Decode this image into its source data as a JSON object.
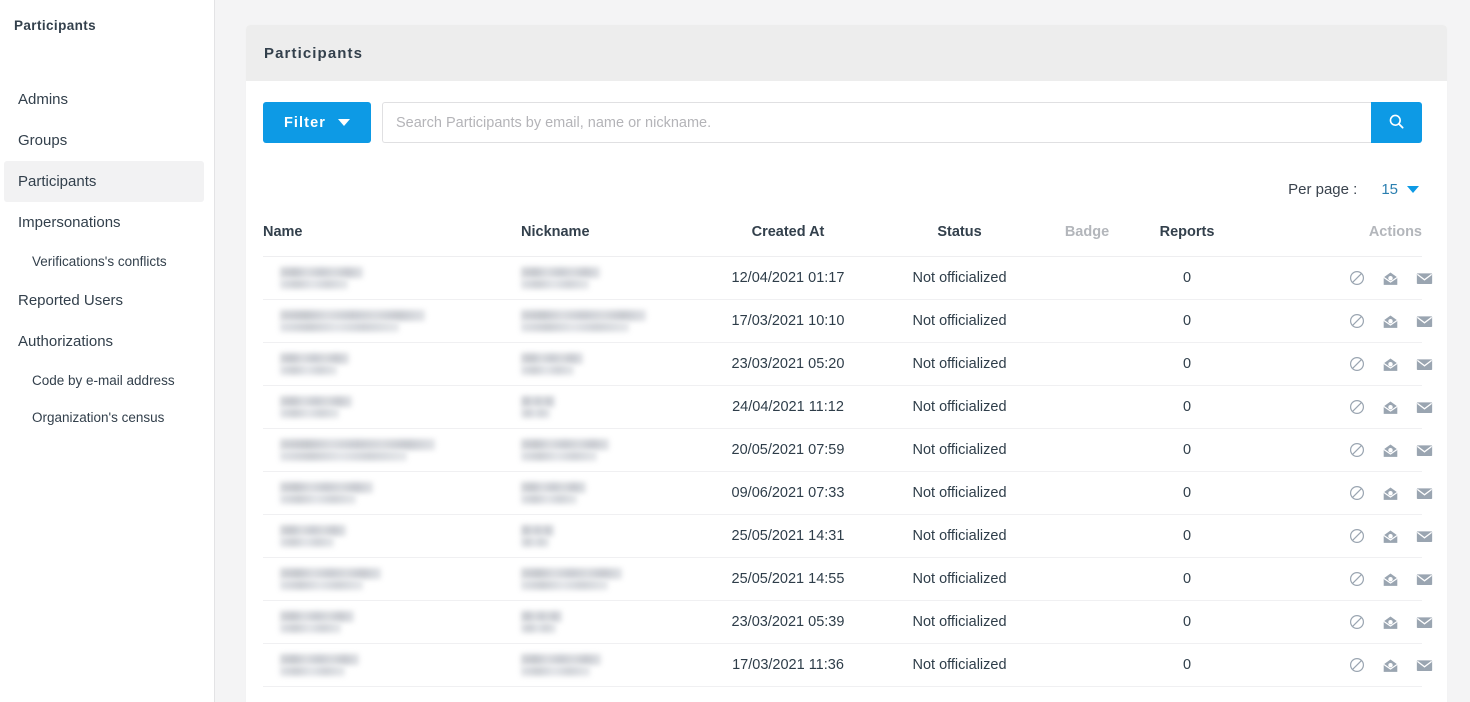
{
  "sidebar": {
    "title": "Participants",
    "items": [
      {
        "label": "Admins",
        "sub": false,
        "active": false
      },
      {
        "label": "Groups",
        "sub": false,
        "active": false
      },
      {
        "label": "Participants",
        "sub": false,
        "active": true
      },
      {
        "label": "Impersonations",
        "sub": false,
        "active": false
      },
      {
        "label": "Verifications's conflicts",
        "sub": true,
        "active": false
      },
      {
        "label": "Reported Users",
        "sub": false,
        "active": false
      },
      {
        "label": "Authorizations",
        "sub": false,
        "active": false
      },
      {
        "label": "Code by e-mail address",
        "sub": true,
        "active": false
      },
      {
        "label": "Organization's census",
        "sub": true,
        "active": false
      }
    ]
  },
  "panel": {
    "header_title": "Participants"
  },
  "toolbar": {
    "filter_label": "Filter",
    "filter_caret_icon": "chevron-down-icon",
    "search_placeholder": "Search Participants by email, name or nickname.",
    "search_value": "",
    "search_button_icon": "search-icon"
  },
  "pagination": {
    "per_page_label": "Per page :",
    "per_page_value": "15",
    "caret_icon": "chevron-down-icon"
  },
  "table": {
    "columns": [
      {
        "key": "name",
        "label": "Name",
        "muted": false
      },
      {
        "key": "nickname",
        "label": "Nickname",
        "muted": false
      },
      {
        "key": "created_at",
        "label": "Created At",
        "muted": false
      },
      {
        "key": "status",
        "label": "Status",
        "muted": false
      },
      {
        "key": "badge",
        "label": "Badge",
        "muted": true
      },
      {
        "key": "reports",
        "label": "Reports",
        "muted": false
      },
      {
        "key": "actions",
        "label": "Actions",
        "muted": true
      }
    ],
    "action_icons": [
      "block-icon",
      "envelope-open-icon",
      "envelope-closed-icon",
      "check-circle-icon",
      "pencil-icon",
      "close-circle-icon"
    ],
    "rows": [
      {
        "name": "",
        "name_redacted": true,
        "name_width": 83,
        "nickname": "",
        "nickname_redacted": true,
        "nickname_width": 79,
        "created_at": "12/04/2021 01:17",
        "status": "Not officialized",
        "badge": "",
        "reports": "0"
      },
      {
        "name": "",
        "name_redacted": true,
        "name_width": 145,
        "nickname": "",
        "nickname_redacted": true,
        "nickname_width": 125,
        "created_at": "17/03/2021 10:10",
        "status": "Not officialized",
        "badge": "",
        "reports": "0"
      },
      {
        "name": "",
        "name_redacted": true,
        "name_width": 69,
        "nickname": "",
        "nickname_redacted": true,
        "nickname_width": 62,
        "created_at": "23/03/2021 05:20",
        "status": "Not officialized",
        "badge": "",
        "reports": "0"
      },
      {
        "name": "",
        "name_redacted": true,
        "name_width": 72,
        "nickname": "",
        "nickname_redacted": true,
        "nickname_width": 34,
        "created_at": "24/04/2021 11:12",
        "status": "Not officialized",
        "badge": "",
        "reports": "0"
      },
      {
        "name": "",
        "name_redacted": true,
        "name_width": 155,
        "nickname": "",
        "nickname_redacted": true,
        "nickname_width": 88,
        "created_at": "20/05/2021 07:59",
        "status": "Not officialized",
        "badge": "",
        "reports": "0"
      },
      {
        "name": "",
        "name_redacted": true,
        "name_width": 93,
        "nickname": "",
        "nickname_redacted": true,
        "nickname_width": 65,
        "created_at": "09/06/2021 07:33",
        "status": "Not officialized",
        "badge": "",
        "reports": "0"
      },
      {
        "name": "",
        "name_redacted": true,
        "name_width": 66,
        "nickname": "",
        "nickname_redacted": true,
        "nickname_width": 33,
        "created_at": "25/05/2021 14:31",
        "status": "Not officialized",
        "badge": "",
        "reports": "0"
      },
      {
        "name": "",
        "name_redacted": true,
        "name_width": 101,
        "nickname": "",
        "nickname_redacted": true,
        "nickname_width": 101,
        "created_at": "25/05/2021 14:55",
        "status": "Not officialized",
        "badge": "",
        "reports": "0"
      },
      {
        "name": "",
        "name_redacted": true,
        "name_width": 74,
        "nickname": "",
        "nickname_redacted": true,
        "nickname_width": 41,
        "created_at": "23/03/2021 05:39",
        "status": "Not officialized",
        "badge": "",
        "reports": "0"
      },
      {
        "name": "",
        "name_redacted": true,
        "name_width": 79,
        "nickname": "",
        "nickname_redacted": true,
        "nickname_width": 80,
        "created_at": "17/03/2021 11:36",
        "status": "Not officialized",
        "badge": "",
        "reports": "0"
      }
    ]
  },
  "colors": {
    "accent_blue": "#0d9ae5",
    "panel_header_bg": "#ededed",
    "page_bg": "#f4f4f5",
    "text": "#2e3d49",
    "muted_text": "#b3b6bb",
    "icon_gray": "#9aa5b1",
    "icon_gray_light": "#cfd5dc"
  }
}
